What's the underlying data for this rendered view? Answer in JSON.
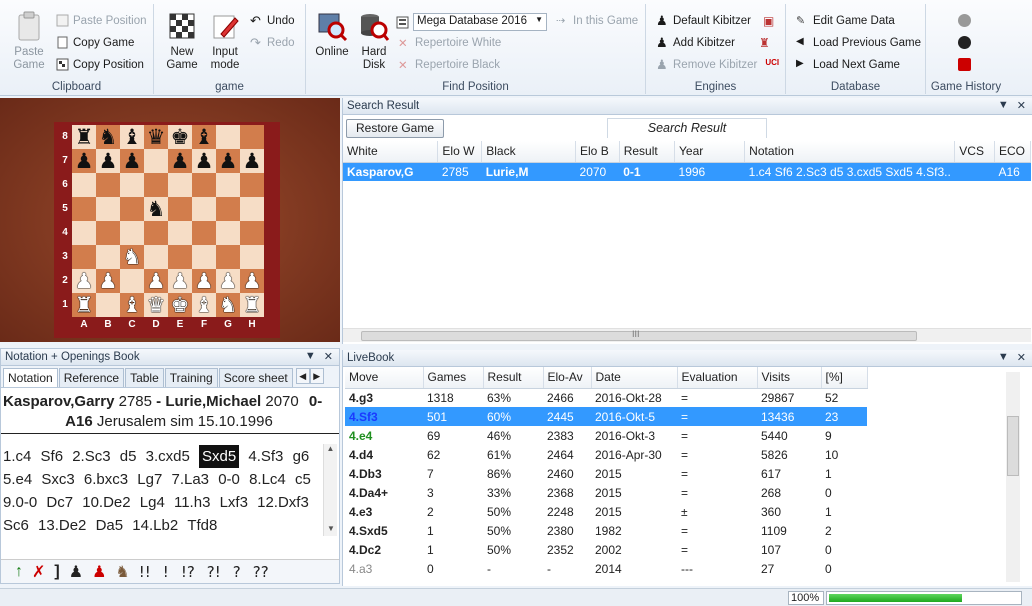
{
  "ribbon": {
    "clipboard": {
      "title": "Clipboard",
      "paste_game": "Paste\nGame",
      "paste_position": "Paste Position",
      "copy_game": "Copy Game",
      "copy_position": "Copy Position"
    },
    "game": {
      "title": "game",
      "new_game": "New\nGame",
      "input_mode": "Input\nmode",
      "undo": "Undo",
      "redo": "Redo"
    },
    "find_position": {
      "title": "Find Position",
      "online": "Online",
      "hard_disk": "Hard\nDisk",
      "database_select": "Mega Database 2016",
      "in_this_game": "In this Game",
      "repertoire_white": "Repertoire White",
      "repertoire_black": "Repertoire Black"
    },
    "engines": {
      "title": "Engines",
      "default_kibitzer": "Default Kibitzer",
      "add_kibitzer": "Add Kibitzer",
      "remove_kibitzer": "Remove Kibitzer"
    },
    "database": {
      "title": "Database",
      "edit_game_data": "Edit Game Data",
      "load_previous_game": "Load Previous Game",
      "load_next_game": "Load Next Game"
    },
    "game_history": {
      "title": "Game History"
    }
  },
  "board": {
    "ranks": [
      "8",
      "7",
      "6",
      "5",
      "4",
      "3",
      "2",
      "1"
    ],
    "files": [
      "A",
      "B",
      "C",
      "D",
      "E",
      "F",
      "G",
      "H"
    ],
    "position": [
      [
        "br",
        "bn",
        "bb",
        "bq",
        "bk",
        "bb",
        "",
        ""
      ],
      [
        "bp",
        "bp",
        "bp",
        "",
        "bp",
        "bp",
        "bp",
        "bp"
      ],
      [
        "",
        "",
        "",
        "",
        "",
        "",
        "",
        ""
      ],
      [
        "",
        "",
        "",
        "bn",
        "",
        "",
        "",
        ""
      ],
      [
        "",
        "",
        "",
        "",
        "",
        "",
        "",
        ""
      ],
      [
        "",
        "",
        "wn",
        "",
        "",
        "",
        "",
        ""
      ],
      [
        "wp",
        "wp",
        "",
        "wp",
        "wp",
        "wp",
        "wp",
        "wp"
      ],
      [
        "wr",
        "",
        "wb",
        "wq",
        "wk",
        "wb",
        "wn",
        "wr"
      ]
    ]
  },
  "notation": {
    "panel_title": "Notation + Openings Book",
    "tabs": [
      "Notation",
      "Reference",
      "Table",
      "Training",
      "Score sheet"
    ],
    "header_white": "Kasparov,Garry",
    "header_white_elo": "2785",
    "header_black": "Lurie,Michael",
    "header_black_elo": "2070",
    "header_result": "0-",
    "header_eco": "A16",
    "header_event": "Jerusalem sim 15.10.1996",
    "moves": [
      "1.c4",
      "Sf6",
      "2.Sc3",
      "d5",
      "3.cxd5",
      "Sxd5",
      "4.Sf3",
      "g6",
      "5.e4",
      "Sxc3",
      "6.bxc3",
      "Lg7",
      "7.La3",
      "0-0",
      "8.Lc4",
      "c5",
      "9.0-0",
      "Dc7",
      "10.De2",
      "Lg4",
      "11.h3",
      "Lxf3",
      "12.Dxf3",
      "Sc6",
      "13.De2",
      "Da5",
      "14.Lb2",
      "Tfd8"
    ],
    "current_move": "Sxd5",
    "annotation_symbols": [
      "!!",
      "!",
      "!?",
      "?!",
      "?",
      "??"
    ]
  },
  "search_result": {
    "panel_title": "Search Result",
    "restore_button": "Restore Game",
    "tab_label": "Search Result",
    "columns": [
      "White",
      "Elo W",
      "Black",
      "Elo B",
      "Result",
      "Year",
      "Notation",
      "VCS",
      "ECO"
    ],
    "rows": [
      [
        "Kasparov,G",
        "2785",
        "Lurie,M",
        "2070",
        "0-1",
        "1996",
        "1.c4 Sf6 2.Sc3 d5 3.cxd5 Sxd5 4.Sf3..",
        "",
        "A16"
      ]
    ],
    "scroll_grip": "III"
  },
  "livebook": {
    "panel_title": "LiveBook",
    "columns": [
      "Move",
      "Games",
      "Result",
      "Elo-Av",
      "Date",
      "Evaluation",
      "Visits",
      "[%]"
    ],
    "rows": [
      [
        "4.g3",
        "1318",
        "63%",
        "2466",
        "2016-Okt-28",
        "=",
        "29867",
        "52"
      ],
      [
        "4.Sf3",
        "501",
        "60%",
        "2445",
        "2016-Okt-5",
        "=",
        "13436",
        "23"
      ],
      [
        "4.e4",
        "69",
        "46%",
        "2383",
        "2016-Okt-3",
        "=",
        "5440",
        "9"
      ],
      [
        "4.d4",
        "62",
        "61%",
        "2464",
        "2016-Apr-30",
        "=",
        "5826",
        "10"
      ],
      [
        "4.Db3",
        "7",
        "86%",
        "2460",
        "2015",
        "=",
        "617",
        "1"
      ],
      [
        "4.Da4+",
        "3",
        "33%",
        "2368",
        "2015",
        "=",
        "268",
        "0"
      ],
      [
        "4.e3",
        "2",
        "50%",
        "2248",
        "2015",
        "±",
        "360",
        "1"
      ],
      [
        "4.Sxd5",
        "1",
        "50%",
        "2380",
        "1982",
        "=",
        "1109",
        "2"
      ],
      [
        "4.Dc2",
        "1",
        "50%",
        "2352",
        "2002",
        "=",
        "107",
        "0"
      ],
      [
        "4.a3",
        "0",
        "-",
        "-",
        "2014",
        "---",
        "27",
        "0"
      ]
    ],
    "selected_index": 1
  },
  "status": {
    "zoom": "100%",
    "progress": 0.7
  },
  "colors": {
    "selection": "#3399ff",
    "board_light": "#f6ddc6",
    "board_dark": "#d27d4c",
    "board_frame": "#8a1b1b"
  }
}
